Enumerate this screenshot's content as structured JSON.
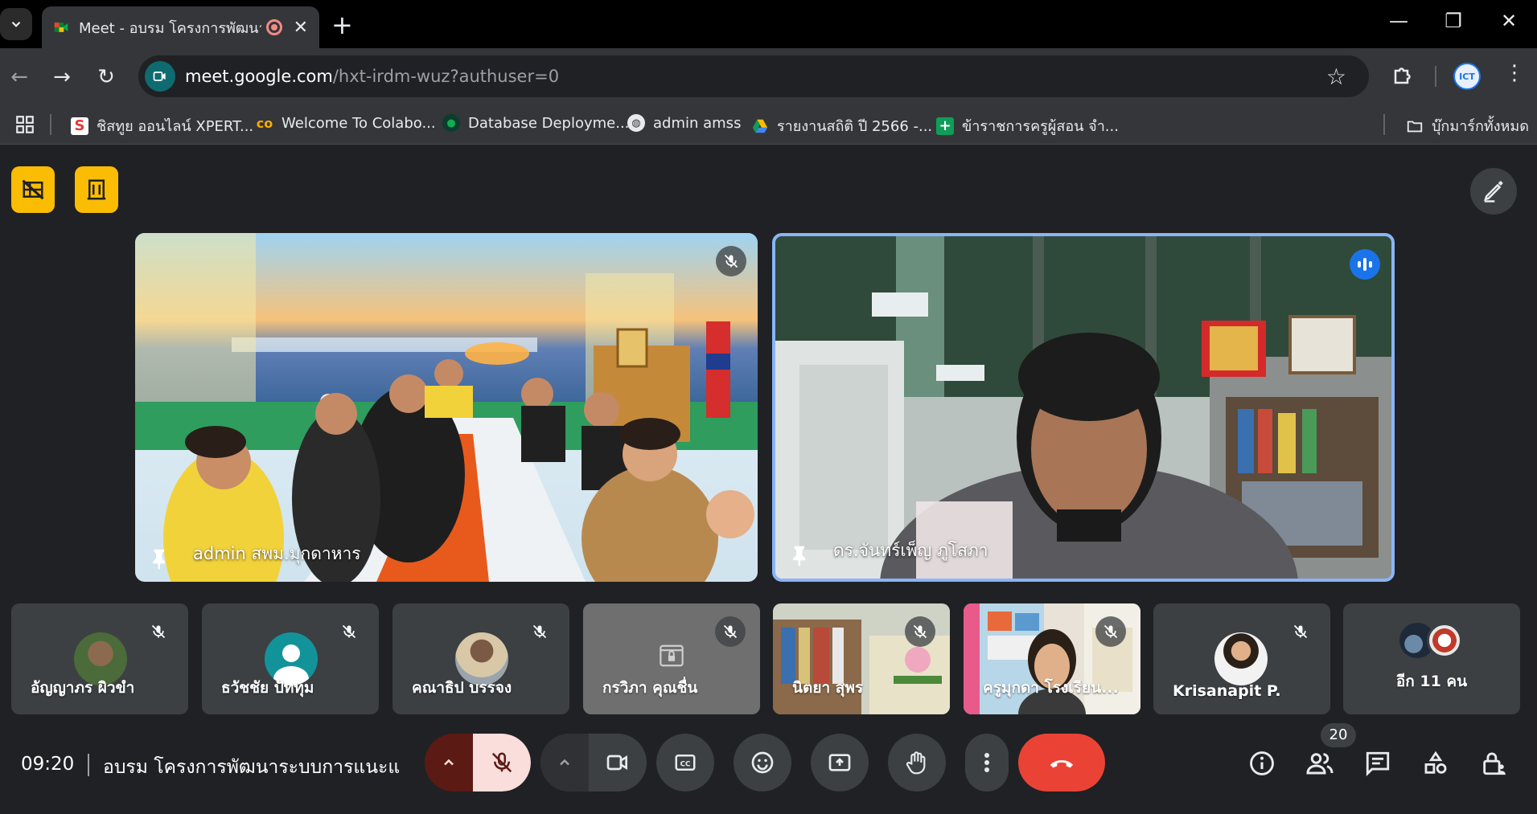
{
  "browser": {
    "tab_title": "Meet - อบรม โครงการพัฒนาระ",
    "url_host": "meet.google.com",
    "url_path": "/hxt-irdm-wuz?authuser=0",
    "profile_label": "ICT",
    "bookmarks": [
      {
        "label": "ชิสทูย ออนไลน์ XPERT..."
      },
      {
        "label": "Welcome To Colabo..."
      },
      {
        "label": "Database Deployme..."
      },
      {
        "label": "admin amss"
      },
      {
        "label": "รายงานสถิติ ปี 2566 -..."
      },
      {
        "label": "ข้าราชการครูผู้สอน จำ..."
      }
    ],
    "all_bookmarks": "บุ๊กมาร์กทั้งหมด"
  },
  "meet": {
    "main_tiles": [
      {
        "name": "admin สพม.มุกดาหาร"
      },
      {
        "name": "ดร.จันทร์เพ็ญ ภูโสภา"
      }
    ],
    "participants": [
      {
        "name": "อัญญาภร ผิวขำ"
      },
      {
        "name": "ธวัชชัย ปัททุม"
      },
      {
        "name": "คณาธิป บรรจง"
      },
      {
        "name": "กรวิภา คุณชื่น"
      },
      {
        "name": "นิตยา สุพร"
      },
      {
        "name": "ครูมุกดา โรงเรียน..."
      },
      {
        "name": "Krisanapit P."
      },
      {
        "name": "อีก 11 คน"
      }
    ],
    "clock": "09:20",
    "meeting_title": "อบรม โครงการพัฒนาระบบการแนะแ...",
    "participant_count": "20"
  },
  "colors": {
    "accent_yellow": "#fbbc04",
    "end_call_red": "#ea4335",
    "speaking_blue": "#1a73e8"
  }
}
